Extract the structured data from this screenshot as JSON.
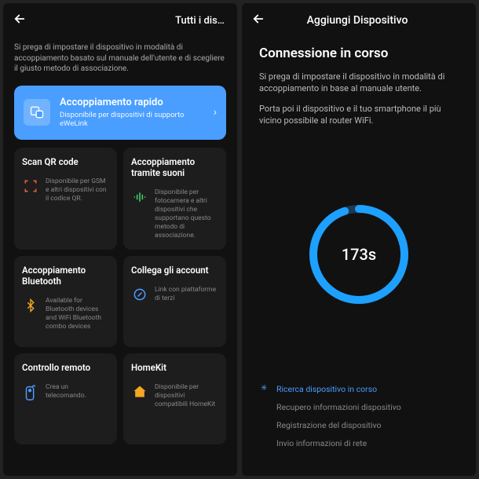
{
  "screen1": {
    "header_title": "Tutti i dis…",
    "intro": "Si prega di impostare il dispositivo in modalità di accoppiamento basato sul manuale dell'utente e di scegliere il giusto metodo di associazione.",
    "primary": {
      "title": "Accoppiamento rapido",
      "sub": "Disponibile per dispositivi di supporto eWeLink"
    },
    "options": [
      {
        "title": "Scan QR code",
        "desc": "Disponibile per GSM e altri dispositivi con il codice QR.",
        "icon": "qr"
      },
      {
        "title": "Accoppiamento tramite suoni",
        "desc": "Disponibile per fotocamera e altri dispositivi che supportano questo metodo di associazione.",
        "icon": "sound"
      },
      {
        "title": "Accoppiamento Bluetooth",
        "desc": "Available for Bluetooth devices and WiFi Bluetooth combo devices",
        "icon": "bt"
      },
      {
        "title": "Collega gli account",
        "desc": "Link con piattaforme di terzi",
        "icon": "link"
      },
      {
        "title": "Controllo remoto",
        "desc": "Crea un telecomando.",
        "icon": "remote"
      },
      {
        "title": "HomeKit",
        "desc": "Disponibile per dispositivi compatibili HomeKit",
        "icon": "home"
      }
    ]
  },
  "screen2": {
    "header_title": "Aggiungi Dispositivo",
    "heading": "Connessione in corso",
    "para1": "Si prega di impostare il dispositivo in modalità di accoppiamento in base al manuale utente.",
    "para2": "Porta poi il dispositivo e il tuo smartphone il più vicino possibile al router WiFi.",
    "timer": "173s",
    "steps": [
      {
        "label": "Ricerca dispositivo in corso",
        "active": true
      },
      {
        "label": "Recupero informazioni dispositivo",
        "active": false
      },
      {
        "label": "Registrazione del dispositivo",
        "active": false
      },
      {
        "label": "Invio informazioni di rete",
        "active": false
      }
    ]
  }
}
